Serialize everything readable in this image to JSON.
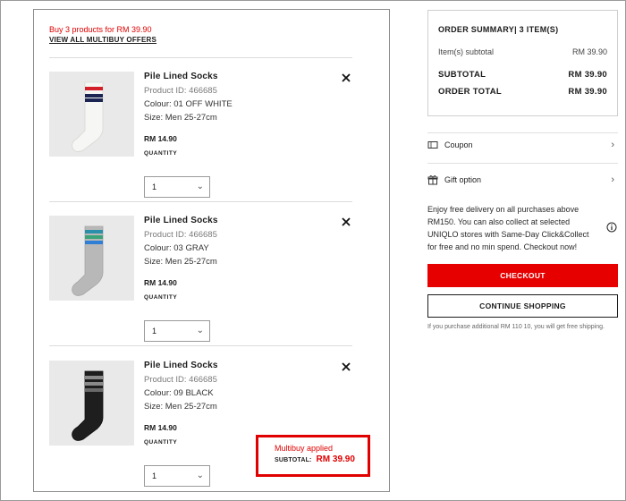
{
  "cart": {
    "promo_text": "Buy 3 products for RM 39.90",
    "promo_link": "VIEW ALL MULTIBUY OFFERS",
    "items": [
      {
        "name": "Pile Lined Socks",
        "product_id": "Product ID: 466685",
        "colour": "Colour: 01 OFF WHITE",
        "size": "Size: Men 25-27cm",
        "price": "RM 14.90",
        "quantity_label": "QUANTITY",
        "quantity": "1",
        "image": "white-sock-navy-red-stripes"
      },
      {
        "name": "Pile Lined Socks",
        "product_id": "Product ID: 466685",
        "colour": "Colour: 03 GRAY",
        "size": "Size: Men 25-27cm",
        "price": "RM 14.90",
        "quantity_label": "QUANTITY",
        "quantity": "1",
        "image": "gray-sock-blue-green-stripes"
      },
      {
        "name": "Pile Lined Socks",
        "product_id": "Product ID: 466685",
        "colour": "Colour: 09 BLACK",
        "size": "Size: Men 25-27cm",
        "price": "RM 14.90",
        "quantity_label": "QUANTITY",
        "quantity": "1",
        "image": "black-sock-gray-stripes"
      }
    ],
    "multibuy": {
      "applied": "Multibuy applied",
      "subtotal_label": "SUBTOTAL:",
      "subtotal_value": "RM 39.90"
    }
  },
  "summary": {
    "title": "ORDER SUMMARY| 3 ITEM(S)",
    "items_subtotal_label": "Item(s) subtotal",
    "items_subtotal_value": "RM 39.90",
    "subtotal_label": "SUBTOTAL",
    "subtotal_value": "RM 39.90",
    "order_total_label": "ORDER TOTAL",
    "order_total_value": "RM 39.90"
  },
  "options": {
    "coupon": "Coupon",
    "gift": "Gift option"
  },
  "delivery_text": "Enjoy free delivery on all purchases above RM150. You can also collect at selected UNIQLO stores with Same-Day Click&Collect for free and no min spend. Checkout now!",
  "buttons": {
    "checkout": "CHECKOUT",
    "continue": "CONTINUE SHOPPING"
  },
  "note": "If you purchase additional RM 110 10, you will get free shipping.",
  "colors": {
    "accent_red": "#e60000",
    "border": "#8c8c8c"
  },
  "icons": {
    "remove": "close-icon",
    "dropdown": "chevron-down-icon",
    "coupon": "coupon-icon",
    "gift": "gift-icon",
    "info": "info-icon",
    "arrow": "chevron-right-icon"
  }
}
